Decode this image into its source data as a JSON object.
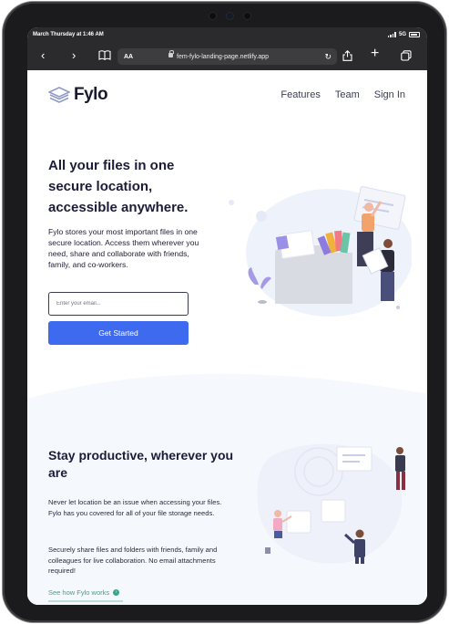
{
  "status": {
    "time": "March Thursday at 1:46 AM",
    "network": "5G"
  },
  "browser": {
    "text_size_label": "AA",
    "url": "fem-fylo-landing-page.netlify.app"
  },
  "site": {
    "logo_text": "Fylo",
    "nav": [
      "Features",
      "Team",
      "Sign In"
    ]
  },
  "hero": {
    "title": "All your files in one secure location, accessible anywhere.",
    "text": "Fylo stores your most important files in one secure location. Access them wherever you need, share and collaborate with friends, family, and co-workers.",
    "email_placeholder": "Enter your email...",
    "cta_label": "Get Started"
  },
  "productive": {
    "title": "Stay productive, wherever you are",
    "paragraph1": "Never let location be an issue when accessing your files. Fylo has you covered for all of your file storage needs.",
    "paragraph2": "Securely share files and folders with friends, family and colleagues for live collaboration. No email attachments required!",
    "link_label": "See how Fylo works"
  },
  "colors": {
    "accent_blue": "#3e6af0",
    "link_teal": "#3ea38e",
    "heading": "#1c1c38",
    "wave_bg": "#f5f8fd"
  }
}
